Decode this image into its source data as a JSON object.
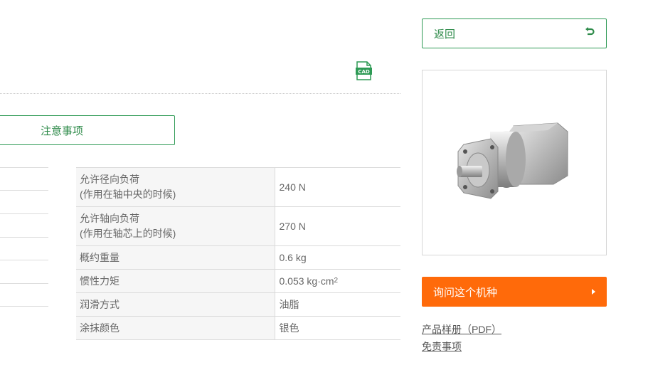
{
  "toolbar": {
    "cad_label": "CAD"
  },
  "notes_button": {
    "label": "注意事项"
  },
  "spec_table": {
    "rows": [
      {
        "key_line1": "允许径向负荷",
        "key_line2": "(作用在轴中央的时候)",
        "value": "240 N"
      },
      {
        "key_line1": "允许轴向负荷",
        "key_line2": "(作用在轴芯上的时候)",
        "value": "270 N"
      },
      {
        "key": "概约重量",
        "value": "0.6 kg"
      },
      {
        "key": "惯性力矩",
        "value": "0.053 kg·cm",
        "value_sup": "2"
      },
      {
        "key": "润滑方式",
        "value": "油脂"
      },
      {
        "key": "涂抹颜色",
        "value": "银色"
      }
    ]
  },
  "sidebar": {
    "back_label": "返回",
    "back_icon": "undo-arrow-icon",
    "inquiry_label": "询问这个机种",
    "links": [
      "产品样册（PDF）",
      "免责事项"
    ]
  },
  "colors": {
    "accent_green": "#2e8b4a",
    "accent_orange": "#ff6a0a"
  }
}
